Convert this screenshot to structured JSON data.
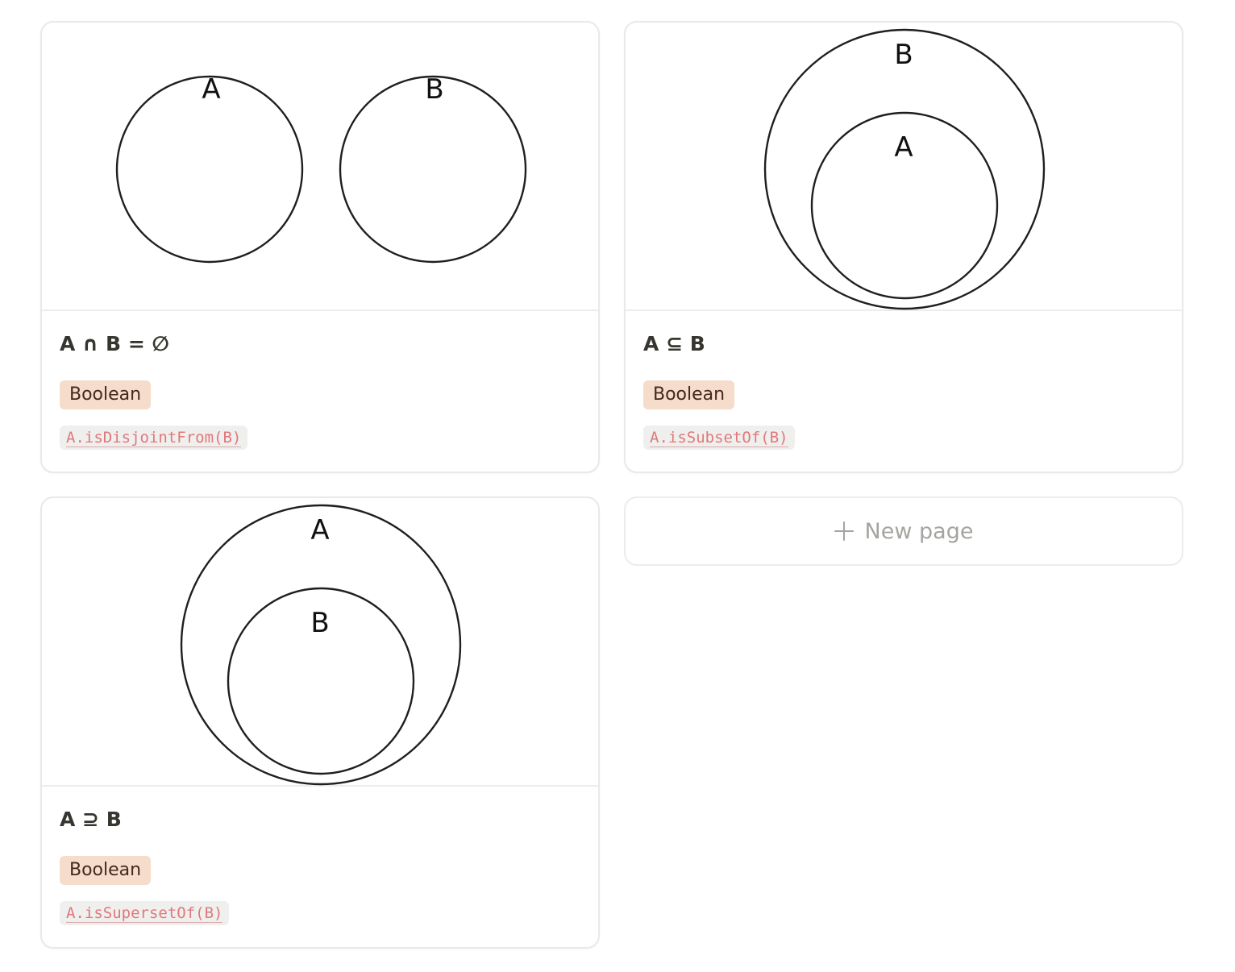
{
  "cards": [
    {
      "title": "A ∩ B = ∅",
      "type_tag": "Boolean",
      "code": "A.isDisjointFrom(B)",
      "diagram": {
        "relation": "disjoint",
        "labels": [
          "A",
          "B"
        ]
      }
    },
    {
      "title": "A ⊆ B",
      "type_tag": "Boolean",
      "code": "A.isSubsetOf(B)",
      "diagram": {
        "relation": "subset",
        "outer_label": "B",
        "inner_label": "A"
      }
    },
    {
      "title": "A ⊇ B",
      "type_tag": "Boolean",
      "code": "A.isSupersetOf(B)",
      "diagram": {
        "relation": "superset",
        "outer_label": "A",
        "inner_label": "B"
      }
    }
  ],
  "new_page": {
    "label": "New page",
    "icon": "plus-icon"
  },
  "colors": {
    "tag_bg": "#f5dccb",
    "tag_text": "#44291c",
    "code_bg": "#efefee",
    "code_text": "#e0787a",
    "border": "#e9e9e7",
    "muted": "#a5a4a0"
  }
}
